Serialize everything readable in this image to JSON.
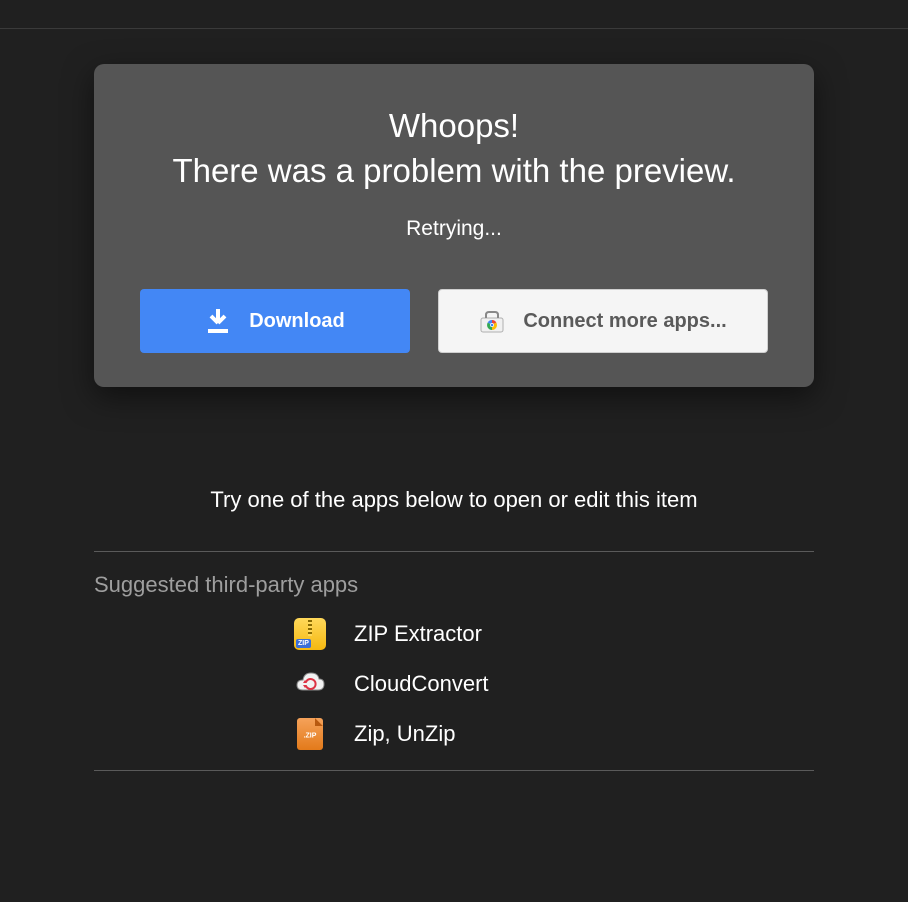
{
  "card": {
    "title_line1": "Whoops!",
    "title_line2": "There was a problem with the preview.",
    "retrying": "Retrying...",
    "download_label": "Download",
    "connect_label": "Connect more apps..."
  },
  "try_text": "Try one of the apps below to open or edit this item",
  "suggested_label": "Suggested third-party apps",
  "apps": [
    {
      "name": "ZIP Extractor",
      "icon": "zip-extractor"
    },
    {
      "name": "CloudConvert",
      "icon": "cloud-convert"
    },
    {
      "name": "Zip, UnZip",
      "icon": "zip-unzip"
    }
  ]
}
